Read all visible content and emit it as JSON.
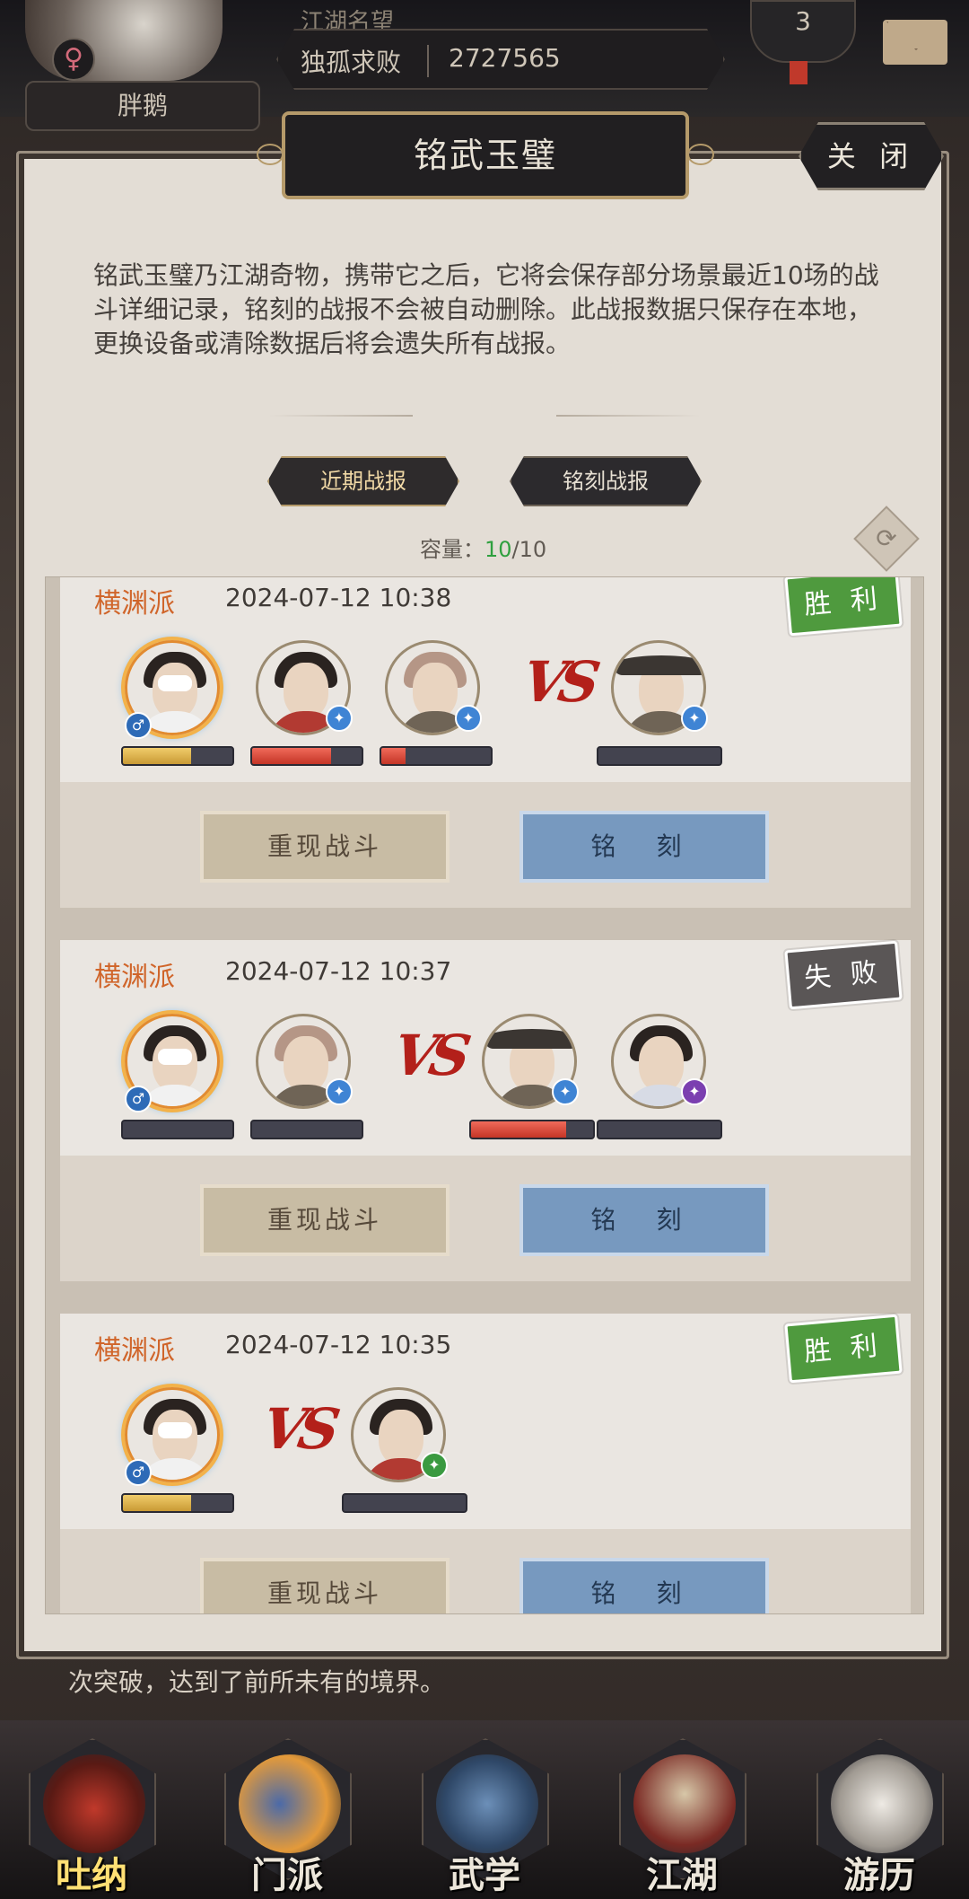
{
  "header": {
    "player_name": "胖鹅",
    "fame_label": "江湖名望",
    "fame_title": "独孤求败",
    "fame_value": "2727565",
    "rank": "3"
  },
  "dialog": {
    "title": "铭武玉璧",
    "close_label": "关 闭",
    "description": "铭武玉璧乃江湖奇物，携带它之后，它将会保存部分场景最近10场的战斗详细记录，铭刻的战报不会被自动删除。此战报数据只保存在本地，更换设备或清除数据后将会遗失所有战报。",
    "tabs": [
      {
        "label": "近期战报",
        "active": true
      },
      {
        "label": "铭刻战报",
        "active": false
      }
    ],
    "capacity_label": "容量：",
    "capacity_used": "10",
    "capacity_total": "/10"
  },
  "records": [
    {
      "sect": "横渊派",
      "time": "2024-07-12 10:38",
      "result": "胜 利",
      "result_type": "win",
      "allies_hp": [
        0.62,
        0.72,
        0.22
      ],
      "enemies_hp": [
        0.0
      ],
      "replay_label": "重现战斗",
      "engrave_label": "铭 刻"
    },
    {
      "sect": "横渊派",
      "time": "2024-07-12 10:37",
      "result": "失 败",
      "result_type": "lose",
      "allies_hp": [
        0.0,
        0.0
      ],
      "enemies_hp": [
        0.78,
        0.0
      ],
      "replay_label": "重现战斗",
      "engrave_label": "铭 刻"
    },
    {
      "sect": "横渊派",
      "time": "2024-07-12 10:35",
      "result": "胜 利",
      "result_type": "win",
      "allies_hp": [
        0.62
      ],
      "enemies_hp": [
        0.0
      ],
      "replay_label": "重现战斗",
      "engrave_label": "铭 刻"
    }
  ],
  "vs_text": "VS",
  "background_text": {
    "line1": "次突破，达到了前所未有的境界。"
  },
  "nav": [
    {
      "label": "吐纳",
      "active": true
    },
    {
      "label": "门派",
      "active": false
    },
    {
      "label": "武学",
      "active": false
    },
    {
      "label": "江湖",
      "active": false
    },
    {
      "label": "游历",
      "active": false
    }
  ],
  "icons": {
    "gender": "female-symbol-icon",
    "ally_element": "male-symbol-icon",
    "refresh": "refresh-icon",
    "mail": "mail-icon"
  },
  "colors": {
    "win_badge": "#4f9a3e",
    "lose_badge": "#5a5656",
    "sect_text": "#d0652a",
    "capacity_used": "#2fa03f",
    "vs": "#b3201a"
  }
}
